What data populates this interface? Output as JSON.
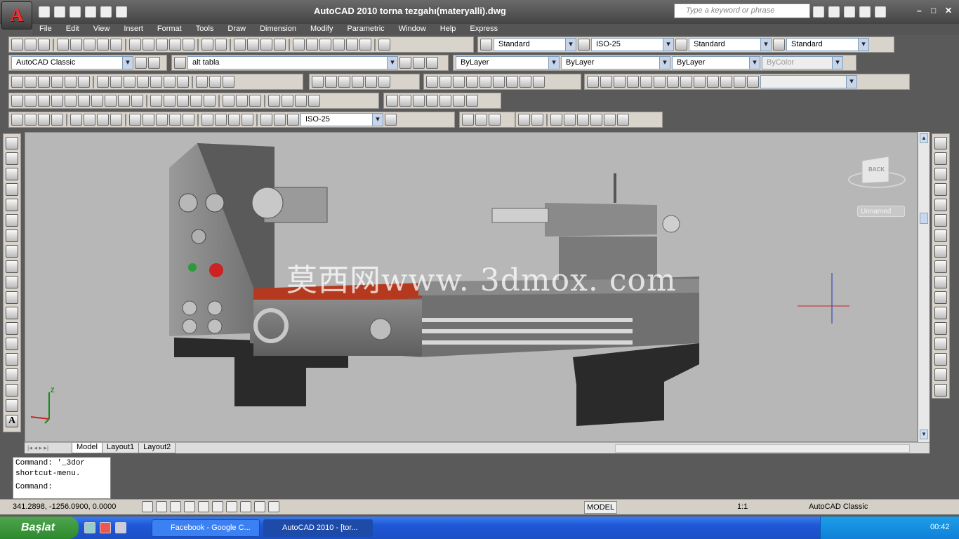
{
  "window": {
    "title": "AutoCAD 2010    torna tezgahı(materyalli).dwg",
    "search_placeholder": "Type a keyword or phrase",
    "controls": [
      "–",
      "□",
      "✕"
    ]
  },
  "menu": [
    "File",
    "Edit",
    "View",
    "Insert",
    "Format",
    "Tools",
    "Draw",
    "Dimension",
    "Modify",
    "Parametric",
    "Window",
    "Help",
    "Express"
  ],
  "styles_toolbar": {
    "text_style": "Standard",
    "dim_style": "ISO-25",
    "table_style": "Standard",
    "multileader_style": "Standard"
  },
  "layers_toolbar": {
    "workspace": "AutoCAD Classic",
    "layer": "alt tabla",
    "color": "ByLayer",
    "linetype": "ByLayer",
    "lineweight": "ByLayer",
    "plotstyle": "ByColor"
  },
  "dim_toolbar": {
    "dim_style": "ISO-25"
  },
  "viewport": {
    "viewcube_label": "BACK",
    "named_view": "Unnamed",
    "watermark": "莫西网www. 3dmox. com",
    "ucs_z": "Z"
  },
  "layout_tabs": [
    "Model",
    "Layout1",
    "Layout2"
  ],
  "command": {
    "line1": "Command: '_3dor",
    "line2": "shortcut-menu.",
    "prompt": "Command:"
  },
  "status": {
    "coords": "341.2898, -1256.0900, 0.0000",
    "model": "MODEL",
    "scale": "1:1",
    "workspace": "AutoCAD Classic"
  },
  "taskbar": {
    "start": "Başlat",
    "tasks": [
      "Facebook - Google C...",
      "AutoCAD 2010 - [tor..."
    ],
    "clock": "00:42"
  },
  "colors": {
    "accent_red": "#cc2222",
    "taskbar_blue": "#245edb",
    "start_green": "#3c963c"
  }
}
